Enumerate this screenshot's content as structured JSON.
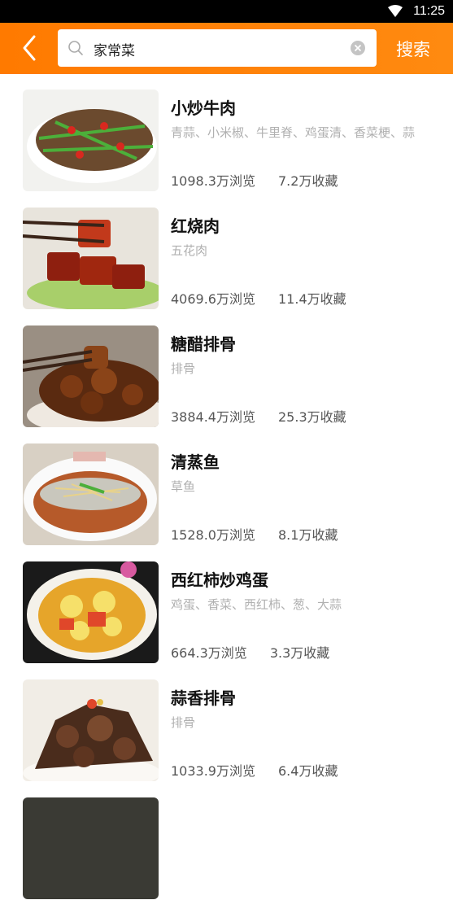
{
  "status_bar": {
    "time": "11:25"
  },
  "search": {
    "query": "家常菜",
    "button_label": "搜索"
  },
  "items": [
    {
      "title": "小炒牛肉",
      "ingredients": "青蒜、小米椒、牛里脊、鸡蛋清、香菜梗、蒜",
      "views": "1098.3万浏览",
      "favorites": "7.2万收藏"
    },
    {
      "title": "红烧肉",
      "ingredients": "五花肉",
      "views": "4069.6万浏览",
      "favorites": "11.4万收藏"
    },
    {
      "title": "糖醋排骨",
      "ingredients": "排骨",
      "views": "3884.4万浏览",
      "favorites": "25.3万收藏"
    },
    {
      "title": "清蒸鱼",
      "ingredients": "草鱼",
      "views": "1528.0万浏览",
      "favorites": "8.1万收藏"
    },
    {
      "title": "西红柿炒鸡蛋",
      "ingredients": "鸡蛋、香菜、西红柿、葱、大蒜",
      "views": "664.3万浏览",
      "favorites": "3.3万收藏"
    },
    {
      "title": "蒜香排骨",
      "ingredients": "排骨",
      "views": "1033.9万浏览",
      "favorites": "6.4万收藏"
    }
  ]
}
